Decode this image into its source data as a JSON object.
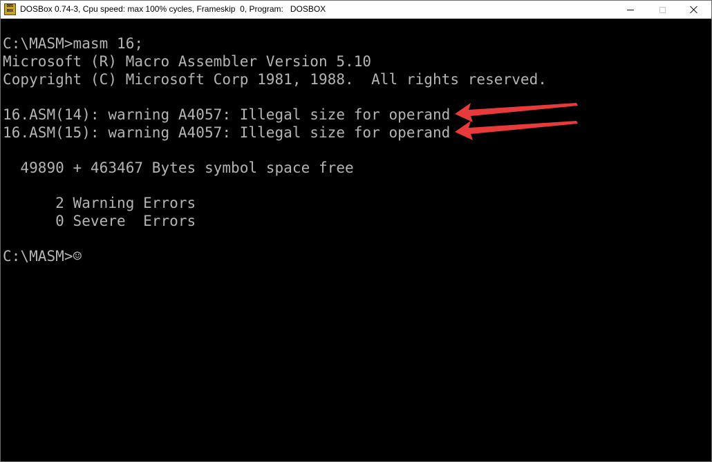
{
  "window": {
    "title": "DOSBox 0.74-3, Cpu speed: max 100% cycles, Frameskip  0, Program:   DOSBOX",
    "icon_text": [
      "DOS",
      "BOX"
    ]
  },
  "console": {
    "lines": [
      "C:\\MASM>masm 16;",
      "Microsoft (R) Macro Assembler Version 5.10",
      "Copyright (C) Microsoft Corp 1981, 1988.  All rights reserved.",
      "",
      "16.ASM(14): warning A4057: Illegal size for operand",
      "16.ASM(15): warning A4057: Illegal size for operand",
      "",
      "  49890 + 463467 Bytes symbol space free",
      "",
      "      2 Warning Errors",
      "      0 Severe  Errors",
      "",
      "C:\\MASM>☺"
    ]
  },
  "colors": {
    "terminal_background": "#000000",
    "terminal_text": "#b4b4b4",
    "annotation_arrow": "#e83a3a"
  }
}
